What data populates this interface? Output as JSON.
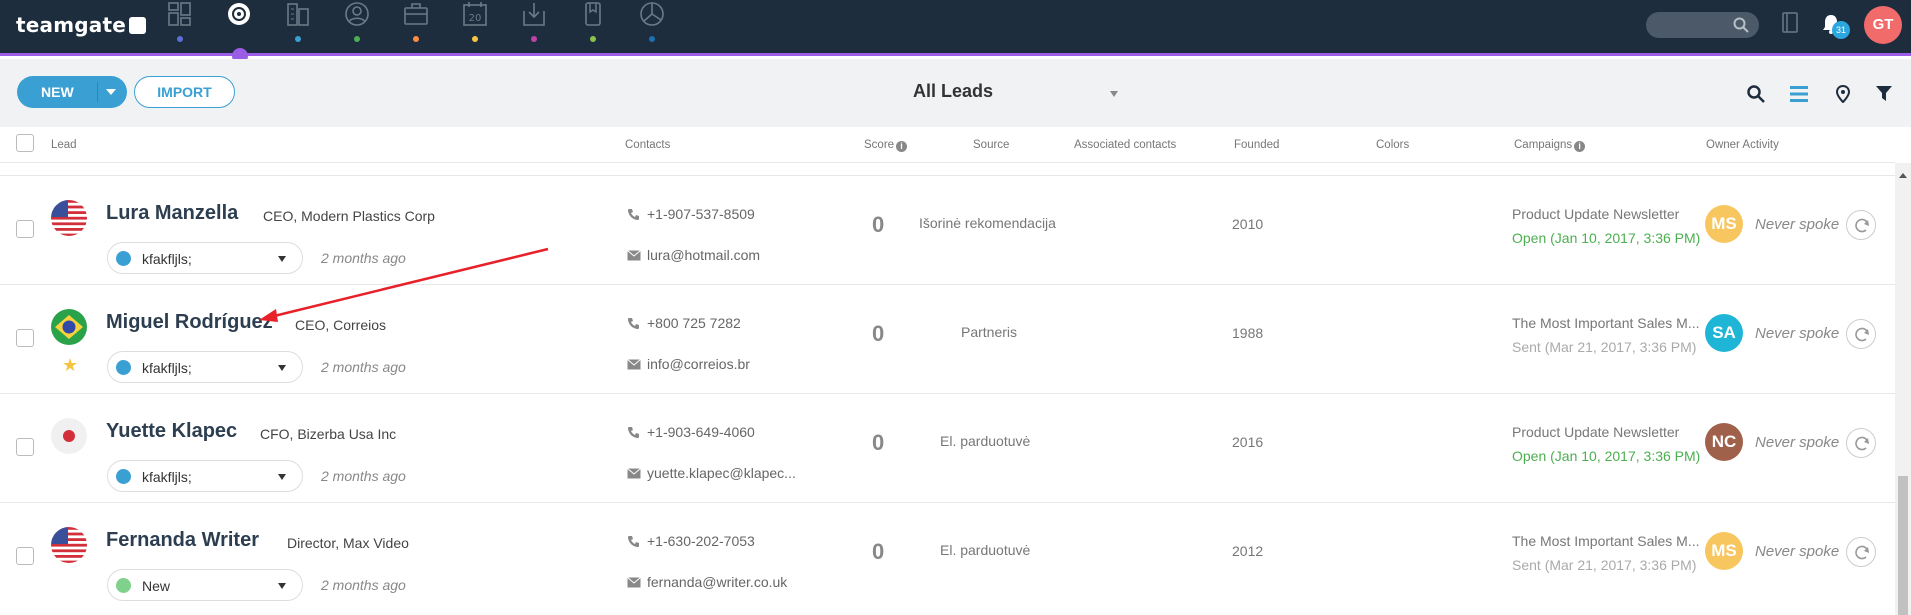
{
  "app": {
    "logo_text": "teamgate"
  },
  "nav": [
    {
      "name": "dashboard-icon",
      "dot": "#5b6fd6"
    },
    {
      "name": "leads-icon",
      "dot": "#9b5de5",
      "active": true
    },
    {
      "name": "companies-icon",
      "dot": "#3aa0d3"
    },
    {
      "name": "contacts-icon",
      "dot": "#4caf50"
    },
    {
      "name": "deals-icon",
      "dot": "#ff8c42"
    },
    {
      "name": "calendar-icon",
      "dot": "#f5c542"
    },
    {
      "name": "inbox-icon",
      "dot": "#c044a8"
    },
    {
      "name": "documents-icon",
      "dot": "#8bc34a"
    },
    {
      "name": "reports-icon",
      "dot": "#1e6fb0"
    }
  ],
  "header": {
    "notifications_count": "31",
    "user_initials": "GT"
  },
  "toolbar": {
    "new_label": "NEW",
    "import_label": "IMPORT",
    "view_label": "All Leads"
  },
  "table": {
    "headers": {
      "lead": "Lead",
      "contacts": "Contacts",
      "score": "Score",
      "source": "Source",
      "associated": "Associated contacts",
      "founded": "Founded",
      "colors": "Colors",
      "campaigns": "Campaigns",
      "owner": "Owner Activity"
    },
    "rows": [
      {
        "name": "Lura Manzella",
        "title": "CEO, Modern Plastics Corp",
        "flag": "us",
        "status": "kfakfljls;",
        "status_color": "#3aa0d3",
        "ago": "2 months ago",
        "phone": "+1-907-537-8509",
        "email": "lura@hotmail.com",
        "score": "0",
        "source": "Išorinė rekomendacija",
        "founded": "2010",
        "campaign": "Product Update Newsletter",
        "campaign_status": "Open (Jan 10, 2017, 3:36 PM)",
        "campaign_status_color": "#4caf50",
        "owner": "MS",
        "owner_color": "#f7c65e",
        "activity": "Never spoke",
        "starred": false
      },
      {
        "name": "Miguel Rodríguez",
        "title": "CEO, Correios",
        "flag": "br",
        "status": "kfakfljls;",
        "status_color": "#3aa0d3",
        "ago": "2 months ago",
        "phone": "+800 725 7282",
        "email": "info@correios.br",
        "score": "0",
        "source": "Partneris",
        "founded": "1988",
        "campaign": "The Most Important Sales M...",
        "campaign_status": "Sent (Mar 21, 2017, 3:36 PM)",
        "campaign_status_color": "#aaaaaa",
        "owner": "SA",
        "owner_color": "#1fb5d6",
        "activity": "Never spoke",
        "starred": true
      },
      {
        "name": "Yuette Klapec",
        "title": "CFO, Bizerba Usa Inc",
        "flag": "jp",
        "status": "kfakfljls;",
        "status_color": "#3aa0d3",
        "ago": "2 months ago",
        "phone": "+1-903-649-4060",
        "email": "yuette.klapec@klapec...",
        "score": "0",
        "source": "El. parduotuvė",
        "founded": "2016",
        "campaign": "Product Update Newsletter",
        "campaign_status": "Open (Jan 10, 2017, 3:36 PM)",
        "campaign_status_color": "#4caf50",
        "owner": "NC",
        "owner_color": "#a0614a",
        "activity": "Never spoke",
        "starred": false
      },
      {
        "name": "Fernanda Writer",
        "title": "Director, Max Video",
        "flag": "us",
        "status": "New",
        "status_color": "#7fd18b",
        "ago": "2 months ago",
        "phone": "+1-630-202-7053",
        "email": "fernanda@writer.co.uk",
        "score": "0",
        "source": "El. parduotuvė",
        "founded": "2012",
        "campaign": "The Most Important Sales M...",
        "campaign_status": "Sent (Mar 21, 2017, 3:36 PM)",
        "campaign_status_color": "#aaaaaa",
        "owner": "MS",
        "owner_color": "#f7c65e",
        "activity": "Never spoke",
        "starred": false
      }
    ]
  }
}
